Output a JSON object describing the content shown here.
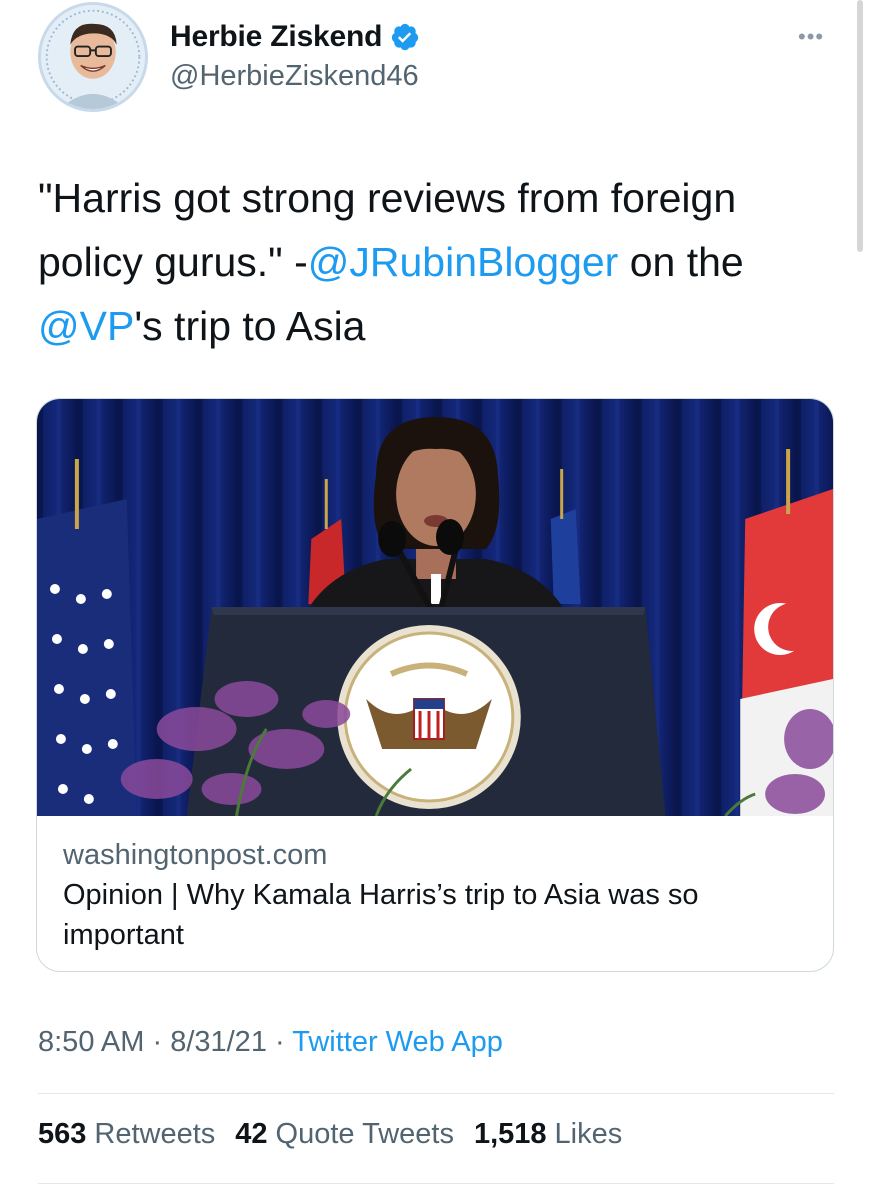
{
  "author": {
    "display_name": "Herbie Ziskend",
    "handle": "@HerbieZiskend46",
    "verified_icon": "verified-badge-icon",
    "avatar_icon": "avatar-photo"
  },
  "tweet": {
    "text_part1": "\"Harris got strong reviews from foreign policy gurus.\" -",
    "mention1": "@JRubinBlogger",
    "text_part2": " on the ",
    "mention2": "@VP",
    "text_part3": "'s trip to Asia"
  },
  "link_card": {
    "domain": "washingtonpost.com",
    "title": "Opinion | Why Kamala Harris’s trip to Asia was so important"
  },
  "meta": {
    "time": "8:50 AM",
    "separator": " · ",
    "date": "8/31/21",
    "source": "Twitter Web App"
  },
  "stats": {
    "retweets_count": "563",
    "retweets_label": "Retweets",
    "quotes_count": "42",
    "quotes_label": "Quote Tweets",
    "likes_count": "1,518",
    "likes_label": "Likes"
  },
  "colors": {
    "link": "#1d9bf0",
    "secondary_text": "#536471",
    "primary_text": "#0f1419"
  }
}
